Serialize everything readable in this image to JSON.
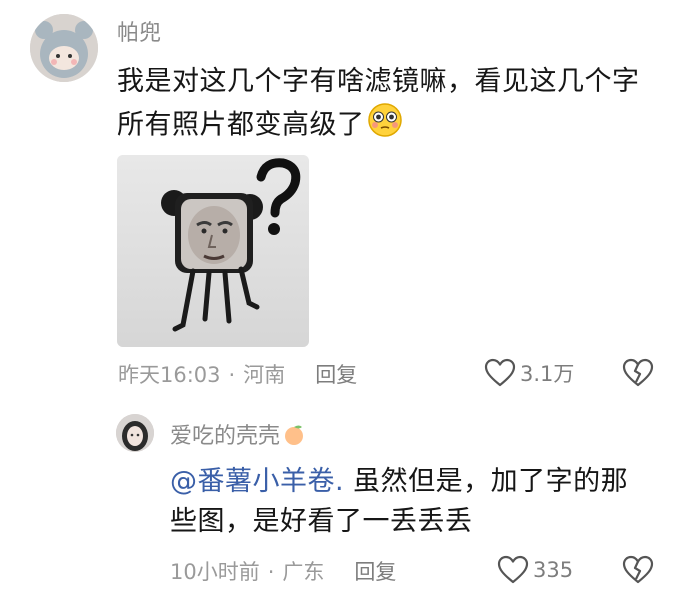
{
  "comment": {
    "username": "帕兜",
    "text_line1": "我是对这几个字有啥滤镜嘛，看见这几个字",
    "text_line2": "所有照片都变高级了",
    "emoji_icon": "flushed-face-emoji",
    "photo_icon": "meme-photo-square-head-with-question-mark",
    "time": "昨天16:03",
    "dot": "·",
    "location": "河南",
    "reply_label": "回复",
    "like_count": "3.1万"
  },
  "reply": {
    "username": "爱吃的壳壳",
    "username_emoji": "peach-emoji",
    "mention": "@番薯小羊卷.",
    "text_part1": " 虽然但是，加了字的那",
    "text_line2": "些图，是好看了一丢丢丢",
    "time": "10小时前",
    "dot": "·",
    "location": "广东",
    "reply_label": "回复",
    "like_count": "335"
  },
  "colors": {
    "mention": "#3a5fa8",
    "meta": "#9a9a9a",
    "username": "#8a8a8a"
  }
}
